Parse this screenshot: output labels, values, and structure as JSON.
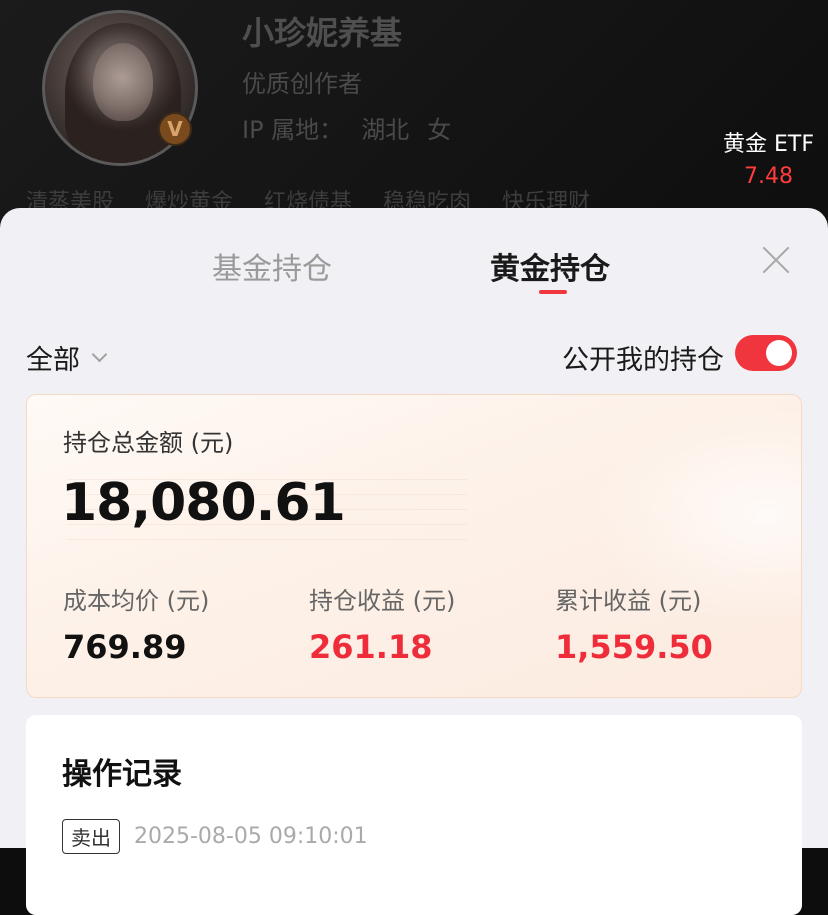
{
  "profile": {
    "nickname": "小珍妮养基",
    "creator_label": "优质创作者",
    "ip_label": "IP 属地：",
    "ip_location": "湖北",
    "gender": "女",
    "badge": "V",
    "tags": [
      "清蒸美股",
      "爆炒黄金",
      "红烧债基",
      "稳稳吃肉",
      "快乐理财"
    ]
  },
  "ticker": {
    "name": "黄金 ETF",
    "value": "7.48",
    "value_color": "#ff3b3b"
  },
  "tabs": [
    {
      "label": "基金持仓",
      "active": false
    },
    {
      "label": "黄金持仓",
      "active": true
    }
  ],
  "filter": {
    "selected": "全部"
  },
  "public_holding": {
    "label": "公开我的持仓",
    "enabled": true
  },
  "summary": {
    "total_label": "持仓总金额 (元)",
    "total_value": "18,080.61",
    "stats": [
      {
        "label": "成本均价 (元)",
        "value": "769.89",
        "color": "black"
      },
      {
        "label": "持仓收益 (元)",
        "value": "261.18",
        "color": "red"
      },
      {
        "label": "累计收益 (元)",
        "value": "1,559.50",
        "color": "red"
      }
    ]
  },
  "records": {
    "title": "操作记录",
    "items": [
      {
        "type": "卖出",
        "time": "2025-08-05 09:10:01"
      }
    ]
  },
  "colors": {
    "accent": "#f0353f",
    "gain": "#ef2c3a"
  }
}
